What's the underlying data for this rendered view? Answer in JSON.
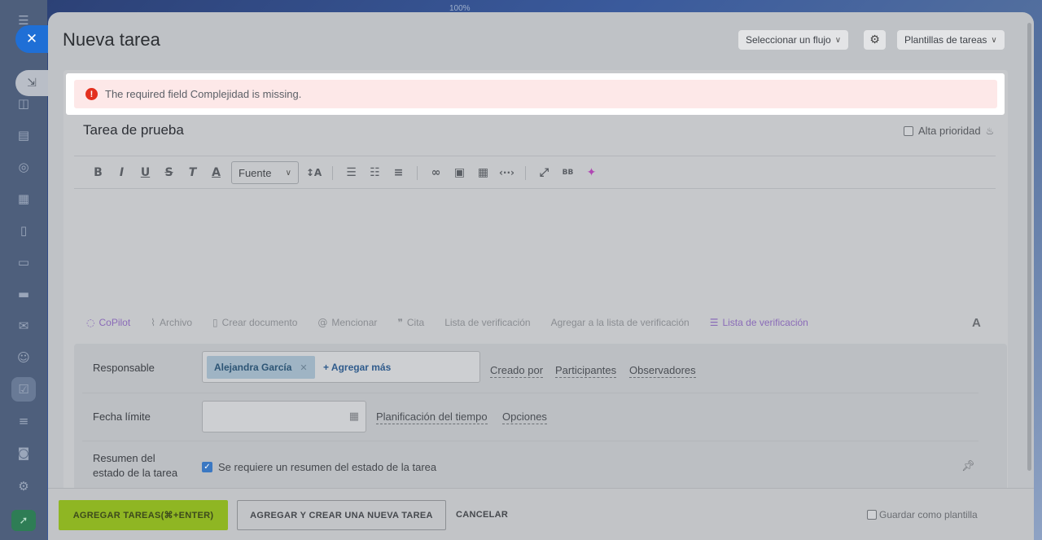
{
  "app": {
    "zoom": "100%"
  },
  "header": {
    "title": "Nueva tarea",
    "flow_label": "Seleccionar un flujo",
    "templates_label": "Plantillas de tareas"
  },
  "error": {
    "message": "The required field Complejidad is missing."
  },
  "task": {
    "title": "Tarea de prueba",
    "priority_label": "Alta prioridad",
    "priority_checked": false
  },
  "editor": {
    "font_select": "Fuente",
    "tools": {
      "copilot": "CoPilot",
      "file": "Archivo",
      "create_doc": "Crear documento",
      "mention": "Mencionar",
      "quote": "Cita",
      "checklist": "Lista de verificación",
      "add_to_checklist": "Agregar a la lista de verificación",
      "checklist2": "Lista de verificación"
    }
  },
  "fields": {
    "responsible_label": "Responsable",
    "assignee": "Alejandra García",
    "add_more": "+ Agregar más",
    "created_by": "Creado por",
    "participants": "Participantes",
    "observers": "Observadores",
    "deadline_label": "Fecha límite",
    "deadline_value": "",
    "time_planning": "Planificación del tiempo",
    "options": "Opciones",
    "summary_label_1": "Resumen del",
    "summary_label_2": "estado de la tarea",
    "summary_check": "Se requiere un resumen del estado de la tarea",
    "summary_checked": true
  },
  "footer": {
    "add_task": "AGREGAR TAREAS(⌘+ENTER)",
    "add_create_new": "AGREGAR Y CREAR UNA NUEVA TAREA",
    "cancel": "CANCELAR",
    "save_template": "Guardar como plantilla",
    "save_template_checked": false
  },
  "colors": {
    "primary_button": "#8fb623",
    "error_bg": "#fde8e8",
    "error_icon": "#e3301e",
    "sidebar_close": "#1f6fd6",
    "checkbox_checked": "#3b78c2"
  }
}
